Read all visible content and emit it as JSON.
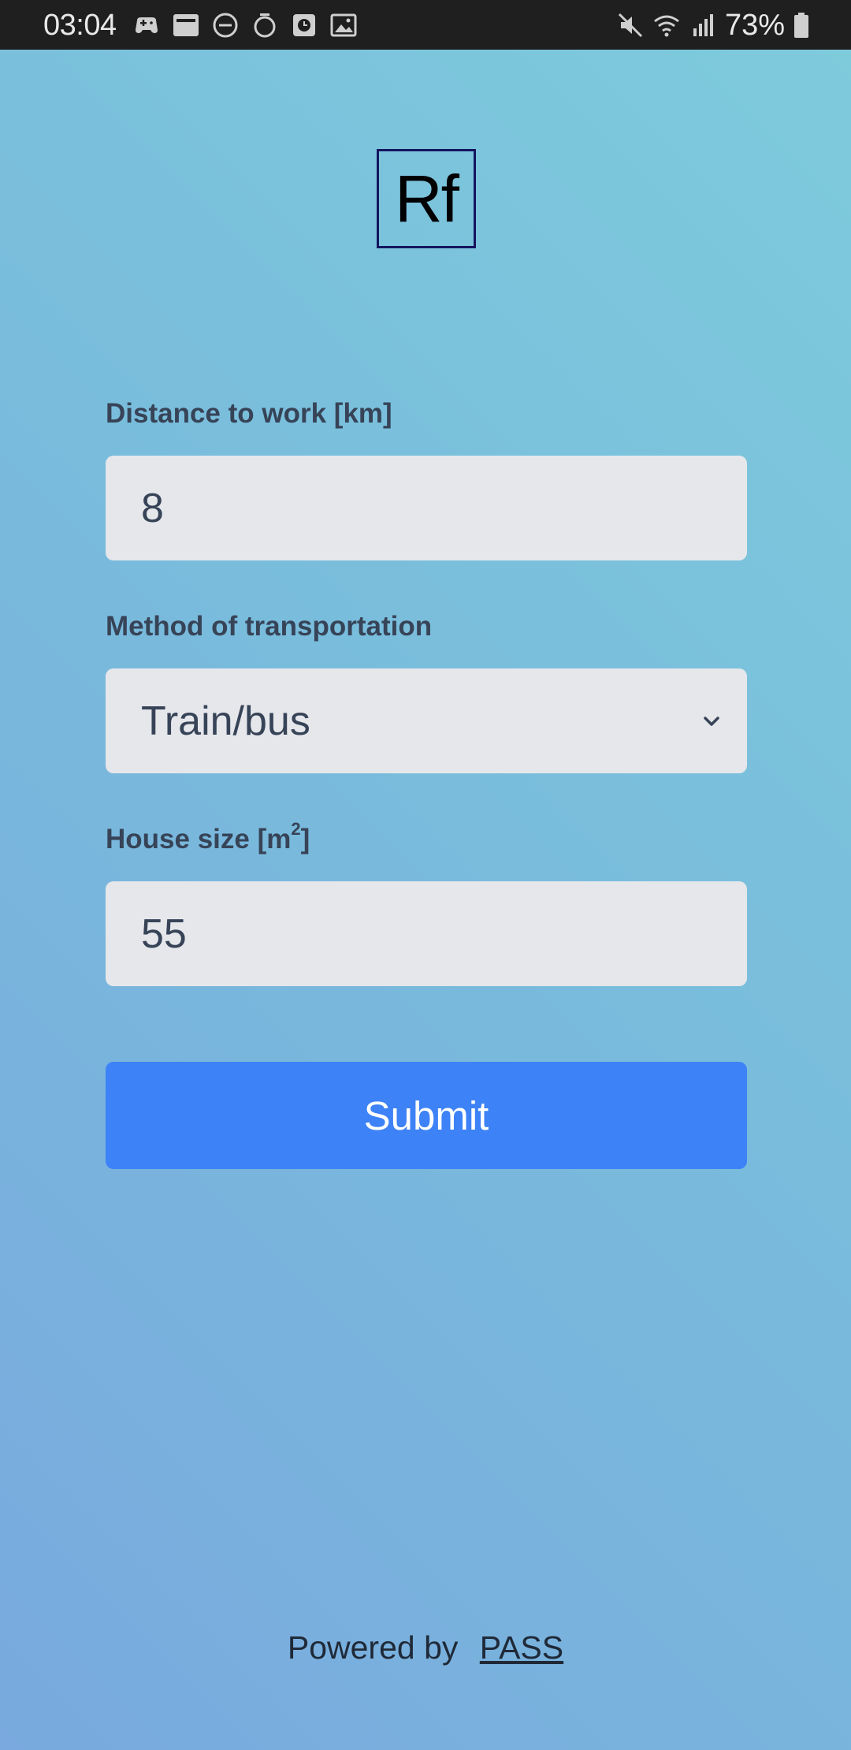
{
  "status_bar": {
    "time": "03:04",
    "left_icons": [
      "game-controller-icon",
      "news-icon",
      "dnd-icon",
      "timer-icon",
      "clock-app-icon",
      "gallery-icon"
    ],
    "right_icons": [
      "mute-icon",
      "wifi-icon",
      "signal-icon"
    ],
    "battery_text": "73%"
  },
  "logo": {
    "text": "Rf"
  },
  "form": {
    "distance": {
      "label": "Distance to work [km]",
      "value": "8"
    },
    "transport": {
      "label": "Method of transportation",
      "selected": "Train/bus"
    },
    "house": {
      "label_prefix": "House size [m",
      "label_sup": "2",
      "label_suffix": "]",
      "value": "55"
    },
    "submit_label": "Submit"
  },
  "footer": {
    "powered_by": "Powered by",
    "link_text": "PASS"
  },
  "colors": {
    "submit": "#3d82f6",
    "field_bg": "#e5e7eb",
    "label": "#374357",
    "logo_border": "#14145e"
  }
}
